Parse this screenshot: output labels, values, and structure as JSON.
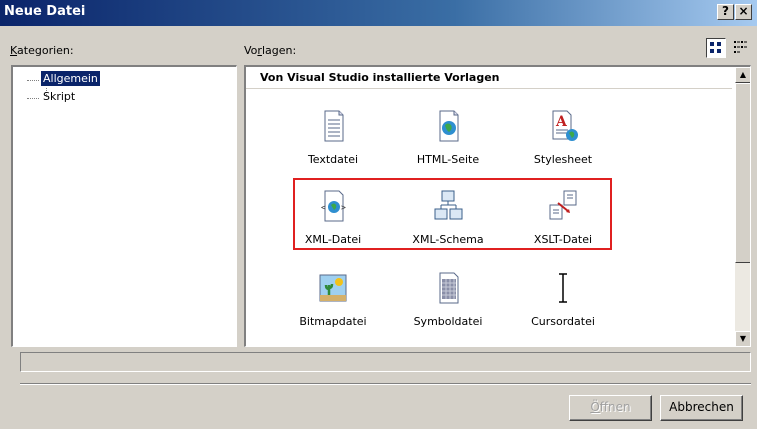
{
  "window": {
    "title": "Neue Datei",
    "help_button": "?",
    "close_button": "×"
  },
  "labels": {
    "categories_prefix": "K",
    "categories_rest": "ategorien:",
    "templates_prefix": "Vo",
    "templates_underlined": "r",
    "templates_rest": "lagen:"
  },
  "tree": {
    "items": [
      {
        "label": "Allgemein",
        "selected": true
      },
      {
        "label": "Skript",
        "selected": false
      }
    ]
  },
  "templates": {
    "section_header": "Von Visual Studio installierte Vorlagen",
    "items": [
      {
        "label": "Textdatei",
        "icon": "text-file-icon"
      },
      {
        "label": "HTML-Seite",
        "icon": "html-page-icon"
      },
      {
        "label": "Stylesheet",
        "icon": "stylesheet-icon"
      },
      {
        "label": "XML-Datei",
        "icon": "xml-file-icon"
      },
      {
        "label": "XML-Schema",
        "icon": "xml-schema-icon"
      },
      {
        "label": "XSLT-Datei",
        "icon": "xslt-file-icon"
      },
      {
        "label": "Bitmapdatei",
        "icon": "bitmap-file-icon"
      },
      {
        "label": "Symboldatei",
        "icon": "icon-file-icon"
      },
      {
        "label": "Cursordatei",
        "icon": "cursor-file-icon"
      }
    ]
  },
  "view_buttons": {
    "large_icons": "large-icons-view-icon",
    "small_icons": "small-icons-view-icon"
  },
  "status": {
    "text": ""
  },
  "buttons": {
    "open_prefix": "Ö",
    "open_rest": "ffnen",
    "open_enabled": false,
    "cancel": "Abbrechen"
  },
  "colors": {
    "title_bar": "#0a246a",
    "selection": "#0a246a",
    "highlight_box": "#e02020",
    "dialog_bg": "#d4d0c8"
  }
}
